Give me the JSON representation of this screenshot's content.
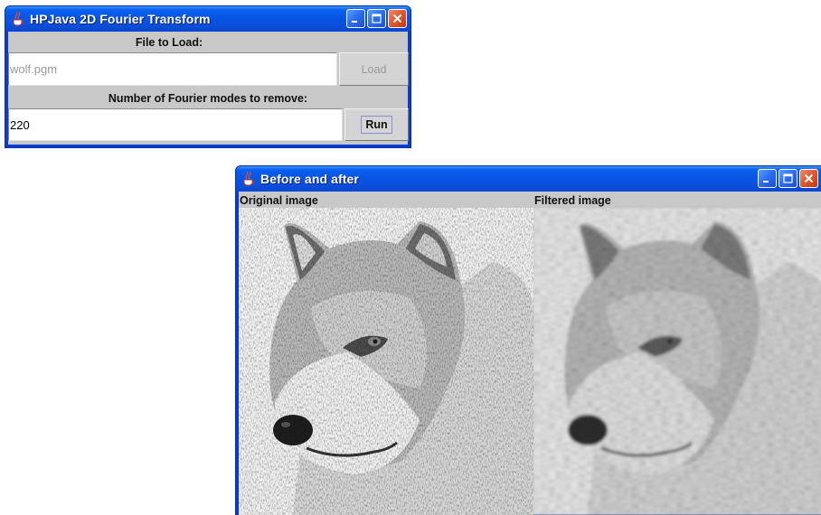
{
  "fourier_window": {
    "title": "HPJava 2D Fourier Transform",
    "file_label": "File to Load:",
    "file_value": "wolf.pgm",
    "load_button": "Load",
    "modes_label": "Number of Fourier modes to remove:",
    "modes_value": "220",
    "run_button": "Run"
  },
  "result_window": {
    "title": "Before and after",
    "original_label": "Original image",
    "filtered_label": "Filtered image",
    "filtered_blur": 1.6
  },
  "titlebar_icons": [
    "java-cup-icon",
    "minimize-icon",
    "maximize-icon",
    "close-icon"
  ],
  "colors": {
    "titlebar_blue": "#0a61f0",
    "client_gray": "#c8c8c8",
    "close_red": "#e0582e",
    "disabled_text": "#9a9a9a"
  }
}
